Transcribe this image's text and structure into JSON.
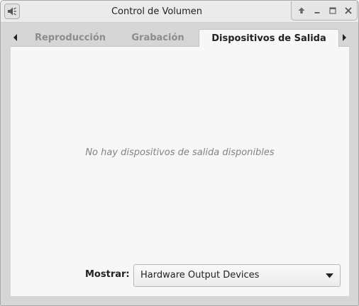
{
  "window": {
    "title": "Control de Volumen",
    "icon": "audio-volume-muted-icon"
  },
  "titlebar_buttons": [
    {
      "name": "shade",
      "icon": "arrow-up-icon"
    },
    {
      "name": "minimize",
      "icon": "minimize-icon"
    },
    {
      "name": "maximize",
      "icon": "maximize-icon"
    },
    {
      "name": "close",
      "icon": "close-icon"
    }
  ],
  "tabs": [
    {
      "label": "Reproducción",
      "active": false
    },
    {
      "label": "Grabación",
      "active": false
    },
    {
      "label": "Dispositivos de Salida",
      "active": true
    }
  ],
  "page": {
    "empty_message": "No hay dispositivos de salida disponibles",
    "show_label": "Mostrar:",
    "show_selected": "Hardware Output Devices"
  },
  "colors": {
    "page_bg": "#f7f7f7",
    "window_bg": "#d6d6d6",
    "inactive_tab_text": "#8c8c8c",
    "empty_text": "#828282"
  }
}
